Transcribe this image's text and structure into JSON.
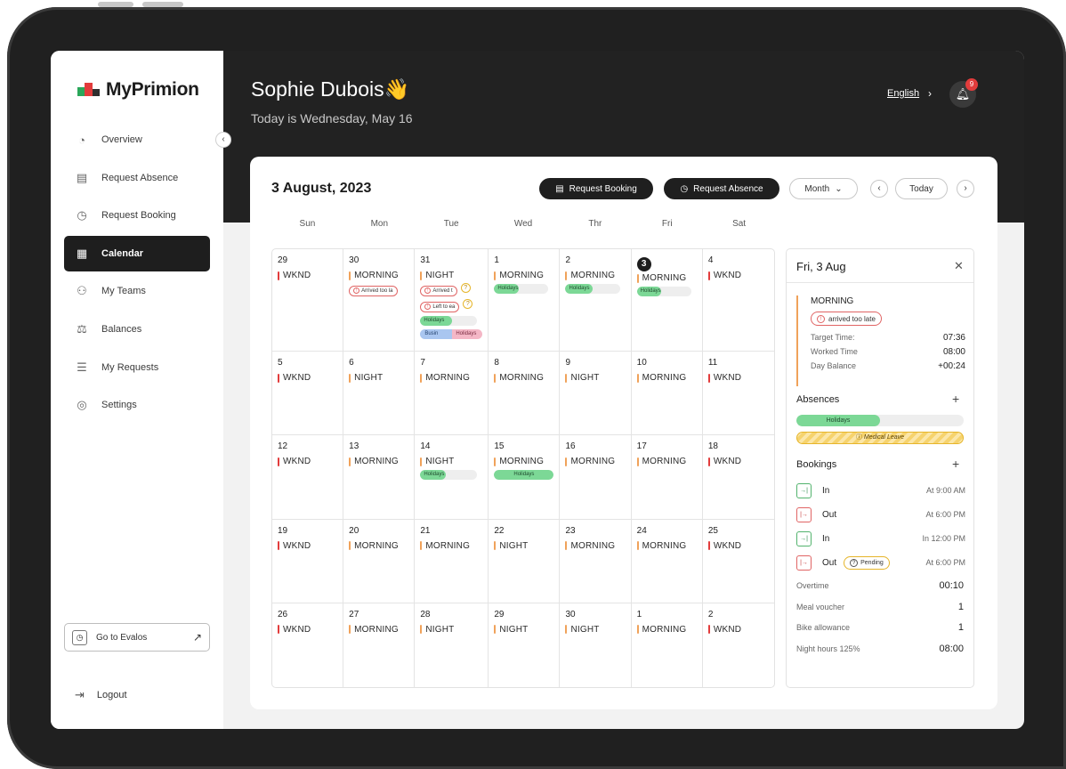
{
  "app": {
    "name": "MyPrimion",
    "brand_colors": [
      "#2aa75a",
      "#e23b3b",
      "#2f2f2f"
    ]
  },
  "sidebar": {
    "items": [
      {
        "label": "Overview",
        "icon": "gauge-icon"
      },
      {
        "label": "Request Absence",
        "icon": "calendar-x-icon"
      },
      {
        "label": "Request Booking",
        "icon": "clock-icon"
      },
      {
        "label": "Calendar",
        "icon": "calendar-icon",
        "active": true
      },
      {
        "label": "My Teams",
        "icon": "team-icon"
      },
      {
        "label": "Balances",
        "icon": "scale-icon"
      },
      {
        "label": "My Requests",
        "icon": "list-icon"
      },
      {
        "label": "Settings",
        "icon": "settings-icon"
      }
    ],
    "external_link": "Go to Evalos",
    "logout": "Logout"
  },
  "header": {
    "user_name": "Sophie Dubois👋",
    "today_text": "Today is Wednesday, May 16",
    "language": "English",
    "notifications_count": "9"
  },
  "calendar": {
    "title": "3 August, 2023",
    "buttons": {
      "request_booking": "Request Booking",
      "request_absence": "Request Absence",
      "view": "Month",
      "today": "Today"
    },
    "weekdays": [
      "Sun",
      "Mon",
      "Tue",
      "Wed",
      "Thr",
      "Fri",
      "Sat"
    ],
    "colors": {
      "weekend": "#e23c3c",
      "shift": "#f0a25a",
      "holiday": "#7cd896",
      "business": "#a9c6f0",
      "holiday_pink": "#f4b7c6"
    },
    "weeks": [
      [
        {
          "day": "29",
          "shift": "WKND",
          "weekend": true
        },
        {
          "day": "30",
          "shift": "MORNING",
          "alerts": [
            "Arrived too la"
          ]
        },
        {
          "day": "31",
          "shift": "NIGHT",
          "alerts": [
            "Arrived t",
            "Left to ea"
          ],
          "holiday": "Holidays",
          "holiday_fill": 0.55,
          "business": "Busin",
          "holiday2": "Holidays"
        },
        {
          "day": "1",
          "shift": "MORNING",
          "holiday": "Holidays",
          "holiday_fill": 0.45
        },
        {
          "day": "2",
          "shift": "MORNING",
          "holiday": "Holidays",
          "holiday_fill": 0.5
        },
        {
          "day": "3",
          "shift": "MORNING",
          "holiday": "Holidays",
          "holiday_fill": 0.45,
          "selected": true
        },
        {
          "day": "4",
          "shift": "WKND",
          "weekend": true
        }
      ],
      [
        {
          "day": "5",
          "shift": "WKND",
          "weekend": true
        },
        {
          "day": "6",
          "shift": "NIGHT"
        },
        {
          "day": "7",
          "shift": "MORNING"
        },
        {
          "day": "8",
          "shift": "MORNING"
        },
        {
          "day": "9",
          "shift": "NIGHT"
        },
        {
          "day": "10",
          "shift": "MORNING"
        },
        {
          "day": "11",
          "shift": "WKND",
          "weekend": true
        }
      ],
      [
        {
          "day": "12",
          "shift": "WKND",
          "weekend": true
        },
        {
          "day": "13",
          "shift": "MORNING"
        },
        {
          "day": "14",
          "shift": "NIGHT",
          "holiday": "Holidays",
          "holiday_fill": 0.45
        },
        {
          "day": "15",
          "shift": "MORNING",
          "holiday": "Holidays",
          "holiday_fill": 1.0
        },
        {
          "day": "16",
          "shift": "MORNING"
        },
        {
          "day": "17",
          "shift": "MORNING"
        },
        {
          "day": "18",
          "shift": "WKND",
          "weekend": true
        }
      ],
      [
        {
          "day": "19",
          "shift": "WKND",
          "weekend": true
        },
        {
          "day": "20",
          "shift": "MORNING"
        },
        {
          "day": "21",
          "shift": "MORNING"
        },
        {
          "day": "22",
          "shift": "NIGHT"
        },
        {
          "day": "23",
          "shift": "MORNING"
        },
        {
          "day": "24",
          "shift": "MORNING"
        },
        {
          "day": "25",
          "shift": "WKND",
          "weekend": true
        }
      ],
      [
        {
          "day": "26",
          "shift": "WKND",
          "weekend": true
        },
        {
          "day": "27",
          "shift": "MORNING"
        },
        {
          "day": "28",
          "shift": "NIGHT"
        },
        {
          "day": "29",
          "shift": "NIGHT"
        },
        {
          "day": "30",
          "shift": "NIGHT"
        },
        {
          "day": "1",
          "shift": "MORNING"
        },
        {
          "day": "2",
          "shift": "WKND",
          "weekend": true
        }
      ]
    ]
  },
  "details": {
    "title": "Fri, 3 Aug",
    "shift": "MORNING",
    "alert": "arrived too late",
    "target_label": "Target Time:",
    "target_value": "07:36",
    "worked_label": "Worked Time",
    "worked_value": "08:00",
    "balance_label": "Day Balance",
    "balance_value": "+00:24",
    "absences_title": "Absences",
    "absence_holiday": "Holidays",
    "absence_medical": "Medical Leave",
    "bookings_title": "Bookings",
    "bookings": [
      {
        "type": "In",
        "time": "At 9:00 AM",
        "kind": "in"
      },
      {
        "type": "Out",
        "time": "At 6:00 PM",
        "kind": "out"
      },
      {
        "type": "In",
        "time": "In 12:00 PM",
        "kind": "in"
      },
      {
        "type": "Out",
        "time": "At 6:00 PM",
        "kind": "out",
        "status": "Pending"
      }
    ],
    "overtime_label": "Overtime",
    "overtime_value": "00:10",
    "meal_label": "Meal voucher",
    "meal_value": "1",
    "bike_label": "Bike allowance",
    "bike_value": "1",
    "night_label": "Night hours 125%",
    "night_value": "08:00"
  }
}
